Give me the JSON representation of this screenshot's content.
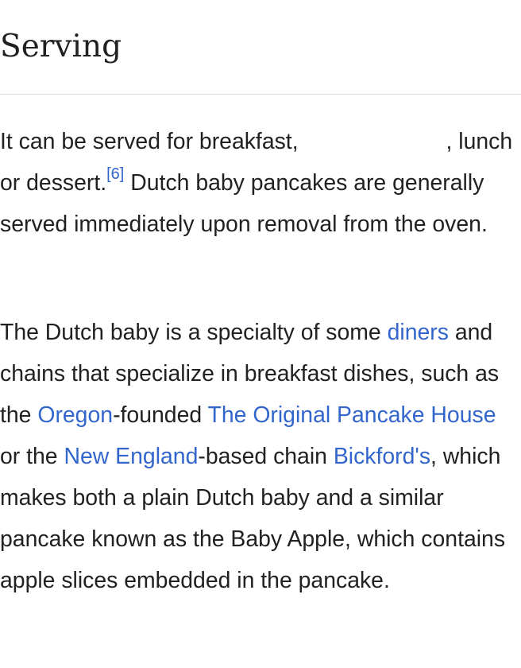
{
  "section": {
    "title": "Serving"
  },
  "p1": {
    "t1": "It can be served for breakfast,",
    "t2": ",",
    "t3": "lunch or dessert.",
    "ref": "[6]",
    "t4": " Dutch baby pancakes are generally served immediately upon removal from the oven."
  },
  "p2": {
    "t1": "The Dutch baby is a specialty of some ",
    "link_diners": "diners",
    "t2": " and chains that specialize in breakfast dishes, such as the ",
    "link_oregon": "Oregon",
    "t3": "-founded ",
    "link_oph": "The Original Pancake House",
    "t4": " or the ",
    "link_ne": "New England",
    "t5": "-based chain ",
    "link_bickfords": "Bickford's",
    "t6": ", which makes both a plain Dutch baby and a similar pancake known as the Baby Apple, which contains apple slices embedded in the pancake."
  },
  "colors": {
    "text": "#202122",
    "link": "#3366cc",
    "rule": "#dddddd"
  }
}
